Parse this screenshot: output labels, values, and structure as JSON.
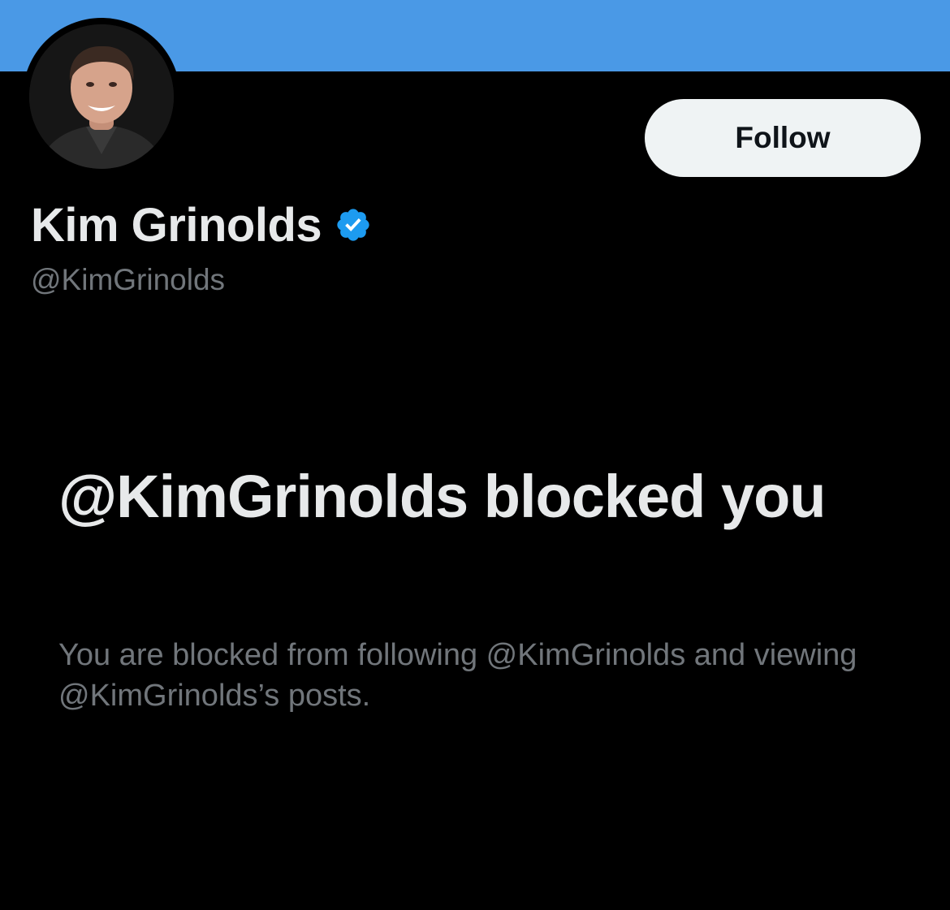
{
  "colors": {
    "banner": "#4a99e6",
    "background": "#000000",
    "primary_text": "#e7e9ea",
    "secondary_text": "#71767b",
    "follow_button_bg": "#eff3f4",
    "follow_button_text": "#0f1419",
    "verified_badge": "#1d9bf0"
  },
  "profile": {
    "display_name": "Kim Grinolds",
    "handle": "@KimGrinolds",
    "verified_icon": "verified-badge-icon",
    "avatar": "profile-photo"
  },
  "actions": {
    "follow_label": "Follow"
  },
  "blocked_notice": {
    "title": "@KimGrinolds blocked you",
    "description": "You are blocked from following @KimGrinolds and viewing @KimGrinolds’s posts."
  }
}
